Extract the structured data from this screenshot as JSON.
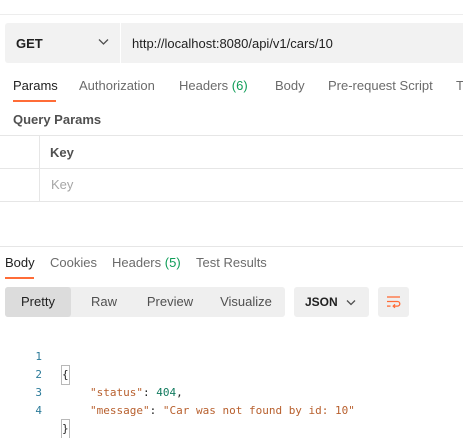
{
  "request": {
    "method": "GET",
    "url": "http://localhost:8080/api/v1/cars/10"
  },
  "request_tabs": {
    "params": "Params",
    "authorization": "Authorization",
    "headers_label": "Headers",
    "headers_count": "(6)",
    "body": "Body",
    "pre_request_script": "Pre-request Script",
    "tests_partial": "T"
  },
  "query_params": {
    "title": "Query Params",
    "key_header": "Key",
    "key_placeholder": "Key"
  },
  "response_tabs": {
    "body": "Body",
    "cookies": "Cookies",
    "headers_label": "Headers",
    "headers_count": "(5)",
    "test_results": "Test Results"
  },
  "response_toolbar": {
    "pretty": "Pretty",
    "raw": "Raw",
    "preview": "Preview",
    "visualize": "Visualize",
    "format": "JSON"
  },
  "response_body": {
    "line_numbers": [
      "1",
      "2",
      "3",
      "4"
    ],
    "open_brace": "{",
    "close_brace": "}",
    "status_key": "\"status\"",
    "status_value": "404",
    "message_key": "\"message\"",
    "message_value": "\"Car was not found by id: 10\""
  },
  "colors": {
    "accent": "#ff6c37",
    "count_green": "#0f9d58",
    "json_key": "#b8602e",
    "json_number": "#117a5e"
  },
  "icons": {
    "method_dropdown": "chevron-down-icon",
    "format_dropdown": "chevron-down-icon",
    "wrap": "wrap-lines-icon"
  }
}
